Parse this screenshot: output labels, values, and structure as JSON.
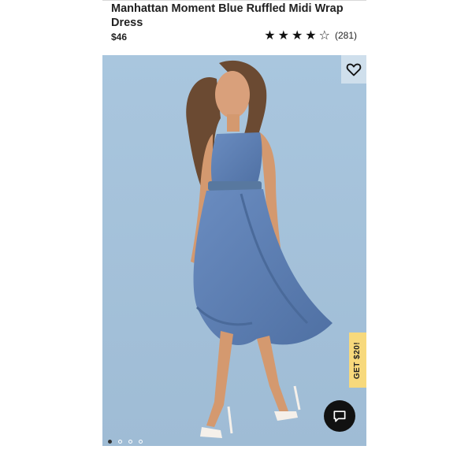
{
  "product": {
    "title": "Manhattan Moment Blue Ruffled Midi Wrap Dress",
    "price": "$46",
    "rating": {
      "filled_stars": 4,
      "total_stars": 5,
      "review_count": "(281)"
    }
  },
  "gallery": {
    "image_description_icon": "dress-photo",
    "dot_count": 4,
    "active_index": 0
  },
  "promo": {
    "label": "GET $20!"
  },
  "icons": {
    "favorite": "heart-icon",
    "chat": "chat-icon"
  },
  "colors": {
    "dress_blue": "#5e7fb3",
    "backdrop": "#a8c4dc",
    "promo_yellow": "#f7d97c",
    "chat_bg": "#111111"
  }
}
